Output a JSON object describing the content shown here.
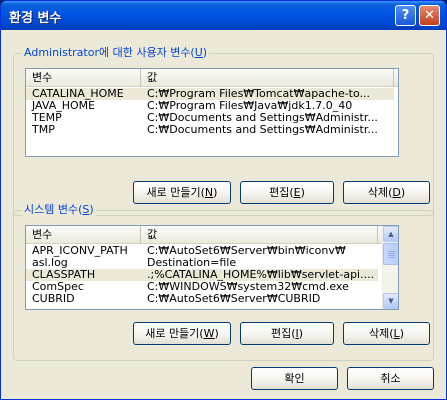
{
  "window": {
    "title": "환경 변수",
    "help_glyph": "?",
    "close_glyph": "✕"
  },
  "user_vars": {
    "legend_prefix": "Administrator에 대한 사용자 변수(",
    "legend_key": "U",
    "legend_suffix": ")",
    "columns": [
      "변수",
      "값"
    ],
    "rows": [
      {
        "name": "CATALINA_HOME",
        "value": "C:₩Program Files₩Tomcat₩apache-to..."
      },
      {
        "name": "JAVA_HOME",
        "value": "C:₩Program Files₩Java₩jdk1.7.0_40"
      },
      {
        "name": "TEMP",
        "value": "C:₩Documents and Settings₩Administr..."
      },
      {
        "name": "TMP",
        "value": "C:₩Documents and Settings₩Administr..."
      }
    ],
    "buttons": {
      "new": {
        "prefix": "새로 만들기(",
        "key": "N",
        "suffix": ")"
      },
      "edit": {
        "prefix": "편집(",
        "key": "E",
        "suffix": ")"
      },
      "delete": {
        "prefix": "삭제(",
        "key": "D",
        "suffix": ")"
      }
    }
  },
  "system_vars": {
    "legend_prefix": "시스템 변수(",
    "legend_key": "S",
    "legend_suffix": ")",
    "columns": [
      "변수",
      "값"
    ],
    "rows": [
      {
        "name": "APR_ICONV_PATH",
        "value": "C:₩AutoSet6₩Server₩bin₩iconv₩"
      },
      {
        "name": "asl.log",
        "value": "Destination=file"
      },
      {
        "name": "CLASSPATH",
        "value": ".;%CATALINA_HOME%₩lib₩servlet-api...."
      },
      {
        "name": "ComSpec",
        "value": "C:₩WINDOWS₩system32₩cmd.exe"
      },
      {
        "name": "CUBRID",
        "value": "C:₩AutoSet6₩Server₩CUBRID"
      }
    ],
    "buttons": {
      "new": {
        "prefix": "새로 만들기(",
        "key": "W",
        "suffix": ")"
      },
      "edit": {
        "prefix": "편집(",
        "key": "I",
        "suffix": ")"
      },
      "delete": {
        "prefix": "삭제(",
        "key": "L",
        "suffix": ")"
      }
    },
    "scroll_up_glyph": "▲",
    "scroll_down_glyph": "▼"
  },
  "dialog_buttons": {
    "ok": "확인",
    "cancel": "취소"
  }
}
